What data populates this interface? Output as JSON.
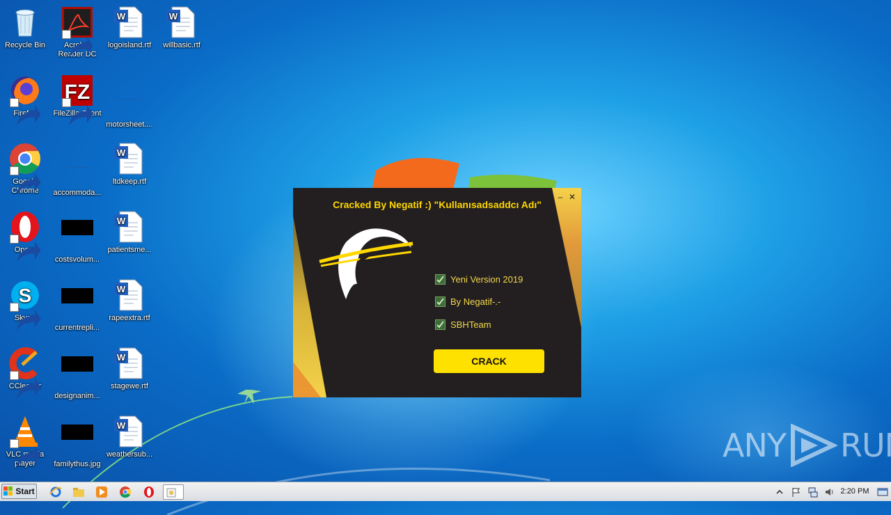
{
  "desktop": {
    "icons": [
      {
        "label": "Recycle Bin",
        "icon": "recycle-bin-icon"
      },
      {
        "label": "Acrobat Reader DC",
        "icon": "acrobat-icon"
      },
      {
        "label": "logoisland.rtf",
        "icon": "word-doc-icon"
      },
      {
        "label": "willbasic.rtf",
        "icon": "word-doc-icon"
      },
      {
        "label": "Firefox",
        "icon": "firefox-icon"
      },
      {
        "label": "FileZilla Client",
        "icon": "filezilla-icon"
      },
      {
        "label": "motorsheet....",
        "icon": "blank-file-icon"
      },
      {
        "label": "Google Chrome",
        "icon": "chrome-icon"
      },
      {
        "label": "accommoda...",
        "icon": "blank-file-icon"
      },
      {
        "label": "ltdkeep.rtf",
        "icon": "word-doc-icon"
      },
      {
        "label": "Opera",
        "icon": "opera-icon"
      },
      {
        "label": "costsvolum...",
        "icon": "black-thumbnail-icon"
      },
      {
        "label": "patientsme...",
        "icon": "word-doc-icon"
      },
      {
        "label": "Skype",
        "icon": "skype-icon"
      },
      {
        "label": "currentrepli...",
        "icon": "black-thumbnail-icon"
      },
      {
        "label": "rapeextra.rtf",
        "icon": "word-doc-icon"
      },
      {
        "label": "CCleaner",
        "icon": "ccleaner-icon"
      },
      {
        "label": "designanim...",
        "icon": "black-thumbnail-icon"
      },
      {
        "label": "stagewe.rtf",
        "icon": "word-doc-icon"
      },
      {
        "label": "VLC media player",
        "icon": "vlc-icon"
      },
      {
        "label": "familythus.jpg",
        "icon": "black-thumbnail-icon"
      },
      {
        "label": "weathersub...",
        "icon": "word-doc-icon"
      }
    ]
  },
  "dialog": {
    "title": "Cracked By Negatif :)  \"Kullanısadsaddcı Adı\"",
    "minimize": "–",
    "close": "✕",
    "checkboxes": [
      {
        "label": "Yeni Version 2019",
        "checked": true
      },
      {
        "label": "By Negatif-.-",
        "checked": true
      },
      {
        "label": "SBHTeam",
        "checked": true
      }
    ],
    "button": "CRACK",
    "colors": {
      "background": "#231f20",
      "accent": "#ffe100",
      "text": "#f2d84a"
    }
  },
  "watermark": {
    "left": "ANY",
    "right": "RUN"
  },
  "taskbar": {
    "start_label": "Start",
    "pinned": [
      "ie-icon",
      "explorer-icon",
      "media-player-icon",
      "chrome-icon",
      "opera-icon",
      "running-app-icon"
    ],
    "clock": "2:20 PM"
  }
}
